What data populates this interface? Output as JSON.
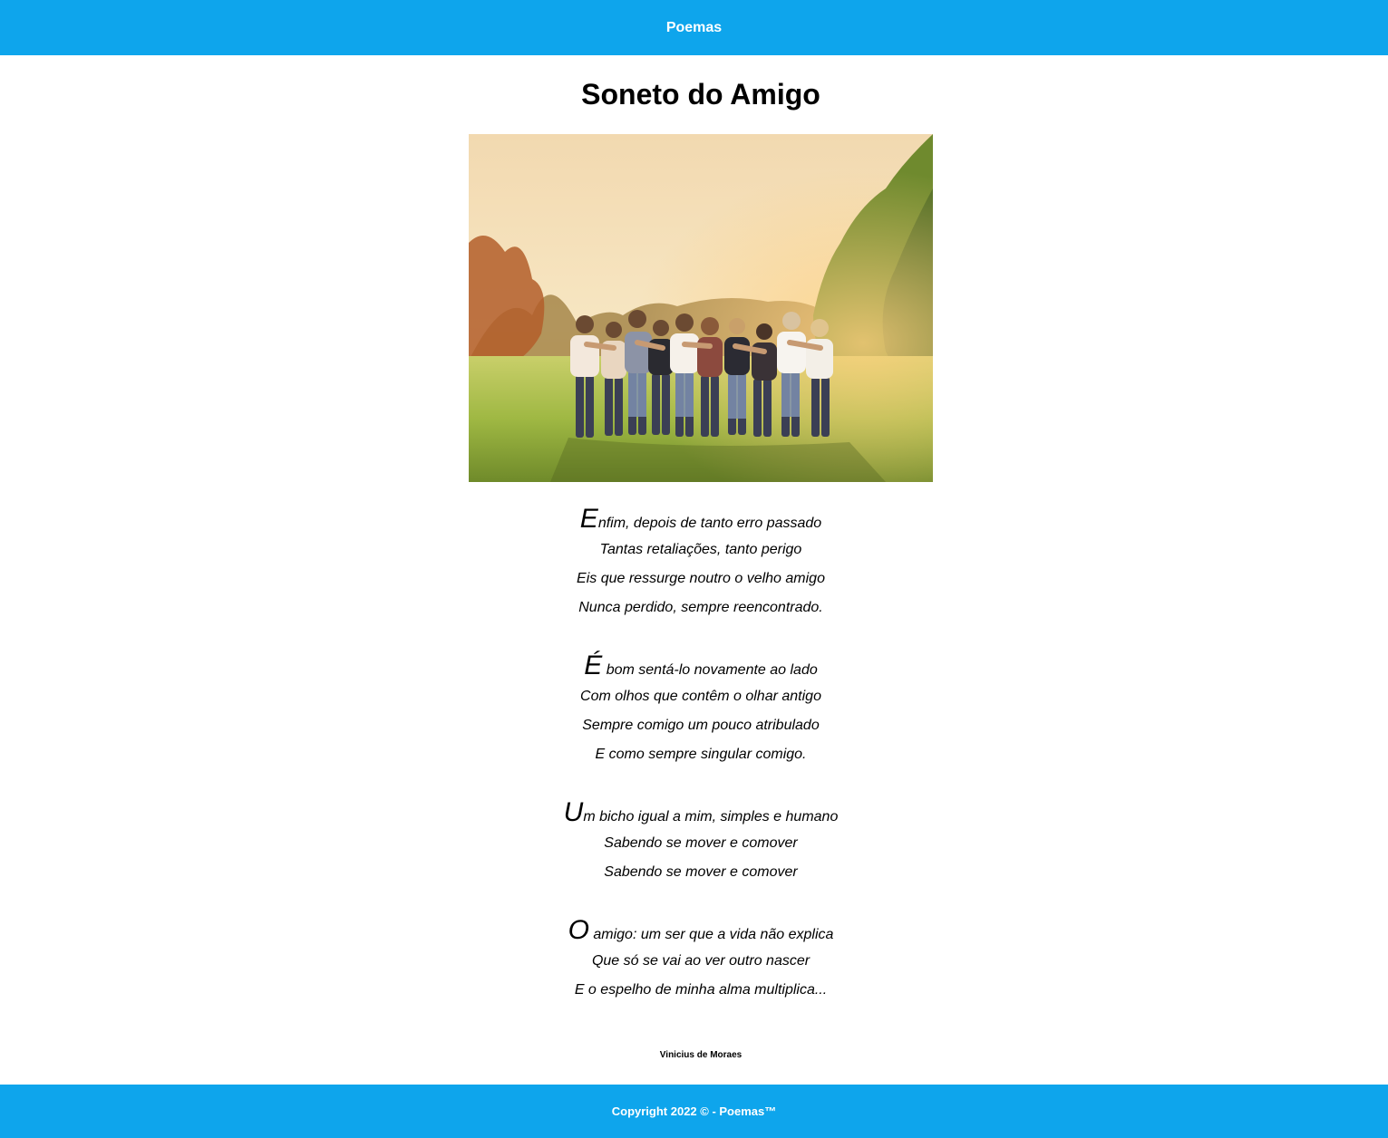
{
  "header": {
    "title": "Poemas"
  },
  "main": {
    "title": "Soneto do Amigo",
    "image": {
      "subject": "group-of-friends-in-park"
    },
    "stanzas": [
      {
        "dropcap": "E",
        "first_rest": "nfim, depois de tanto erro passado",
        "lines": [
          "Tantas retaliações, tanto perigo",
          "Eis que ressurge noutro o velho amigo",
          "Nunca perdido, sempre reencontrado."
        ]
      },
      {
        "dropcap": "É",
        "first_rest": " bom sentá-lo novamente ao lado",
        "lines": [
          "Com olhos que contêm o olhar antigo",
          "Sempre comigo um pouco atribulado",
          "E como sempre singular comigo."
        ]
      },
      {
        "dropcap": "U",
        "first_rest": "m bicho igual a mim, simples e humano",
        "lines": [
          "Sabendo se mover e comover",
          "Sabendo se mover e comover"
        ]
      },
      {
        "dropcap": "O",
        "first_rest": " amigo: um ser que a vida não explica",
        "lines": [
          "Que só se vai ao ver outro nascer",
          "E o espelho de minha alma multiplica..."
        ]
      }
    ],
    "author": "Vinicius de Moraes"
  },
  "footer": {
    "text": "Copyright 2022 © - Poemas™"
  },
  "colors": {
    "brand": "#0ea5ec",
    "text_on_brand": "#ffffff"
  }
}
